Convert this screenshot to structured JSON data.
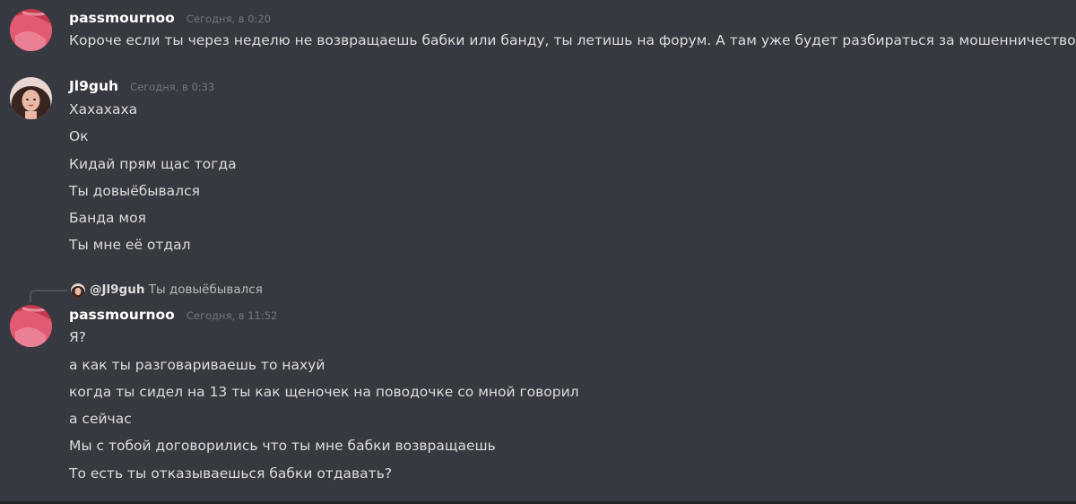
{
  "messages": [
    {
      "author": "passmournoo",
      "timestamp": "Сегодня, в 0:20",
      "avatar_icon": "pink-avatar",
      "lines": [
        "Короче если ты через неделю не возвращаешь бабки или банду, ты летишь на форум. А там уже будет разбираться за мошенничество."
      ]
    },
    {
      "author": "Jl9guh",
      "timestamp": "Сегодня, в 0:33",
      "avatar_icon": "girl-avatar",
      "lines": [
        "Хахахаха",
        "Ок",
        "Кидай прям щас тогда",
        "Ты довыёбывался",
        "Банда моя",
        "Ты мне её отдал"
      ]
    },
    {
      "author": "passmournoo",
      "timestamp": "Сегодня, в 11:52",
      "avatar_icon": "pink-avatar",
      "reply": {
        "mention": "@Jl9guh",
        "text": "Ты довыёбывался"
      },
      "lines": [
        "Я?",
        "а как ты разговариваешь то нахуй",
        "когда ты сидел на 13 ты как щеночек на поводочке со мной говорил",
        "а сейчас",
        "Мы с тобой договорились что ты мне бабки возвращаешь",
        "То есть ты отказываешься бабки отдавать?"
      ]
    }
  ],
  "colors": {
    "background": "#36393f",
    "username": "#ffffff",
    "message_text": "#dcddde",
    "timestamp": "#72767d"
  }
}
